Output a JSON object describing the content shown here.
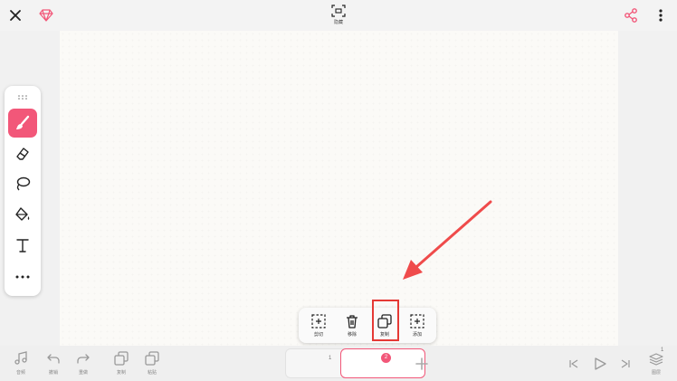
{
  "top_bar": {
    "center_label": "隐藏"
  },
  "context_menu": {
    "items": [
      {
        "label": "剪切"
      },
      {
        "label": "移除"
      },
      {
        "label": "复制"
      },
      {
        "label": "添加"
      }
    ]
  },
  "bottom_bar": {
    "left_items": [
      {
        "label": "音频"
      },
      {
        "label": "撤销"
      },
      {
        "label": "重做"
      },
      {
        "label": "复制"
      },
      {
        "label": "粘贴"
      }
    ],
    "frames": [
      {
        "number": "1"
      },
      {
        "number": "2"
      }
    ],
    "layers_label": "图层",
    "layers_count": "1"
  },
  "colors": {
    "accent": "#f25779",
    "annotation": "#e53935"
  }
}
